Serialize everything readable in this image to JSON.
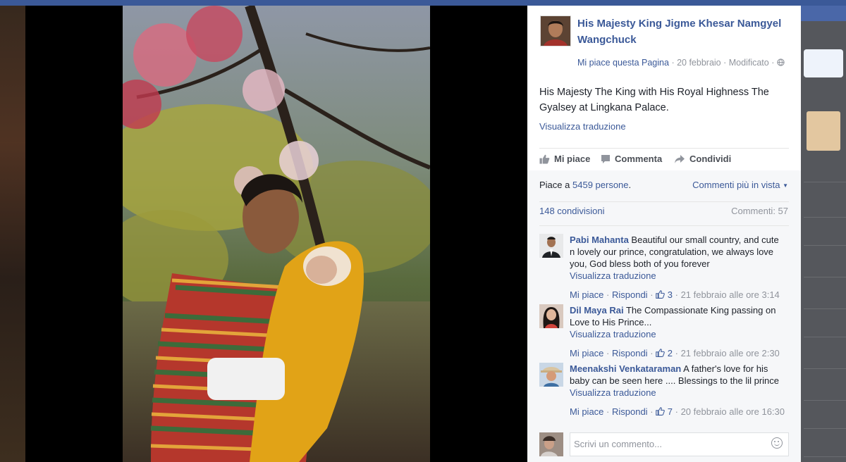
{
  "post": {
    "author": "His Majesty King Jigme Khesar Namgyel Wangchuck",
    "like_page": "Mi piace questa Pagina",
    "date": "20 febbraio",
    "edited": "Modificato",
    "text": "His Majesty The King with His Royal Highness The Gyalsey at Lingkana Palace.",
    "translate": "Visualizza traduzione",
    "actions": {
      "like": "Mi piace",
      "comment": "Commenta",
      "share": "Condividi"
    },
    "likes_prefix": "Piace a",
    "likes_count": "5459 persone",
    "likes_suffix": ".",
    "sort": "Commenti più in vista",
    "shares": "148 condivisioni",
    "comments_total": "Commenti: 57"
  },
  "comments": [
    {
      "name": "Pabi Mahanta",
      "text": "Beautiful our small country, and cute n lovely our prince, congratulation, we always love you, God bless both of you forever",
      "translate": "Visualizza traduzione",
      "like": "Mi piace",
      "reply": "Rispondi",
      "likes": "3",
      "time": "21 febbraio alle ore 3:14"
    },
    {
      "name": "Dil Maya Rai",
      "text": "The Compassionate King passing on Love to His Prince...",
      "translate": "Visualizza traduzione",
      "like": "Mi piace",
      "reply": "Rispondi",
      "likes": "2",
      "time": "21 febbraio alle ore 2:30"
    },
    {
      "name": "Meenakshi Venkataraman",
      "text": "A father's love for his baby can be seen here .... Blessings to the lil prince",
      "translate": "Visualizza traduzione",
      "like": "Mi piace",
      "reply": "Rispondi",
      "likes": "7",
      "time": "20 febbraio alle ore 16:30"
    }
  ],
  "composer": {
    "placeholder": "Scrivi un commento..."
  },
  "icons": {
    "like": "thumbs-up-icon",
    "comment": "speech-bubble-icon",
    "share": "share-arrow-icon",
    "globe": "globe-icon",
    "emoji": "smiley-icon",
    "caret": "caret-down-icon"
  },
  "colors": {
    "link": "#3b5998",
    "muted": "#90949c",
    "text": "#1d2129",
    "panel_bg": "#ffffff",
    "stats_bg": "#f6f7f9",
    "backdrop": "#000000"
  }
}
